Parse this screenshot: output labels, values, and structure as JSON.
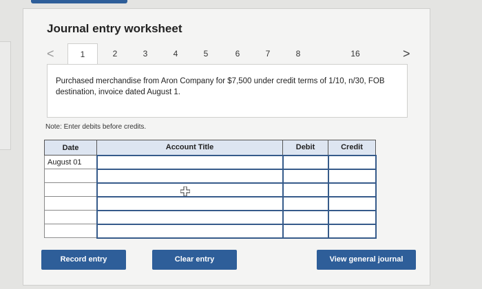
{
  "worksheet": {
    "title": "Journal entry worksheet",
    "tabs": [
      "1",
      "2",
      "3",
      "4",
      "5",
      "6",
      "7",
      "8",
      "16"
    ],
    "active_tab": "1",
    "prev_label": "<",
    "next_label": ">"
  },
  "question": {
    "text": "Purchased merchandise from Aron Company for $7,500 under credit terms of 1/10, n/30, FOB destination, invoice dated August 1."
  },
  "note": "Note: Enter debits before credits.",
  "table": {
    "headers": {
      "date": "Date",
      "account": "Account Title",
      "debit": "Debit",
      "credit": "Credit"
    },
    "rows": [
      {
        "date": "August 01",
        "account": "",
        "debit": "",
        "credit": ""
      },
      {
        "date": "",
        "account": "",
        "debit": "",
        "credit": ""
      },
      {
        "date": "",
        "account": "",
        "debit": "",
        "credit": ""
      },
      {
        "date": "",
        "account": "",
        "debit": "",
        "credit": ""
      },
      {
        "date": "",
        "account": "",
        "debit": "",
        "credit": ""
      },
      {
        "date": "",
        "account": "",
        "debit": "",
        "credit": ""
      }
    ]
  },
  "buttons": {
    "record": "Record entry",
    "clear": "Clear entry",
    "view": "View general journal"
  },
  "colors": {
    "accent": "#2e5e99",
    "header_bg": "#dde5f1"
  },
  "icons": {
    "cursor": "move-cursor-icon"
  }
}
